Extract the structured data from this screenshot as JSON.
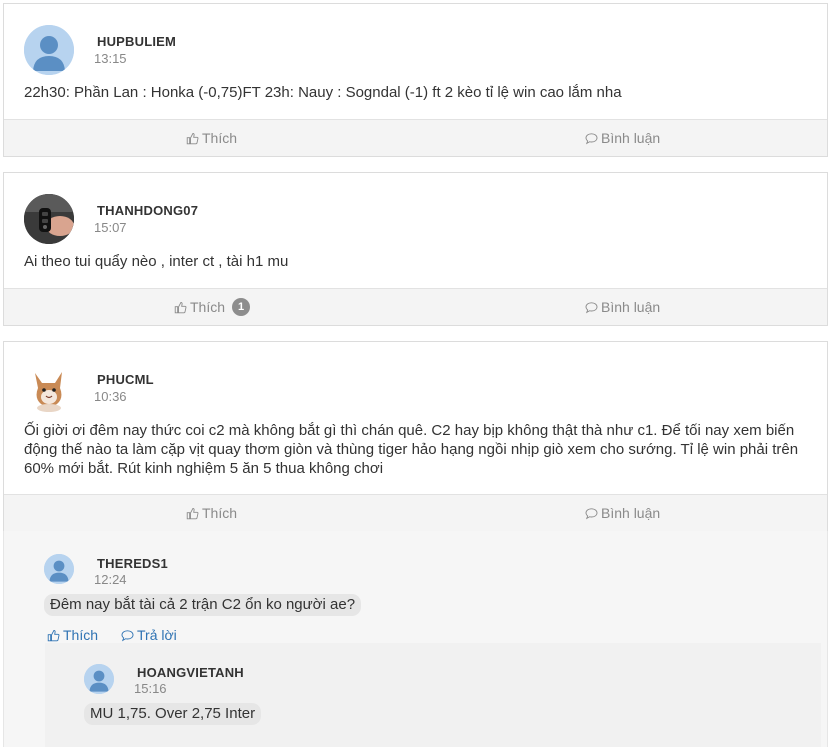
{
  "posts": [
    {
      "username": "HUPBULIEM",
      "time": "13:15",
      "content": "22h30: Phần Lan : Honka (-0,75)FT 23h: Nauy : Sogndal (-1) ft 2 kèo tỉ lệ win cao lắm nha",
      "like_label": "Thích",
      "comment_label": "Bình luận"
    },
    {
      "username": "THANHDONG07",
      "time": "15:07",
      "content": "Ai theo tui quẩy nèo , inter ct , tài h1 mu",
      "like_label": "Thích",
      "like_count": "1",
      "comment_label": "Bình luận"
    },
    {
      "username": "PHUCML",
      "time": "10:36",
      "content": "Ối giời ơi đêm nay thức coi c2 mà không bắt gì thì chán quê. C2 hay bịp không thật thà như c1. Để tối nay xem biến động thế nào ta làm cặp vịt quay thơm giòn và thùng tiger hảo hạng ngồi nhịp giò xem cho sướng. Tỉ lệ win phải trên 60% mới bắt. Rút kinh nghiệm 5 ăn 5 thua không chơi",
      "like_label": "Thích",
      "comment_label": "Bình luận"
    }
  ],
  "comment": {
    "username": "THEREDS1",
    "time": "12:24",
    "content": "Đêm nay bắt tài cả 2 trận C2 ổn ko người ae?",
    "like_label": "Thích",
    "reply_label": "Trả lời"
  },
  "reply": {
    "username": "HOANGVIETANH",
    "time": "15:16",
    "content": "MU 1,75. Over 2,75 Inter"
  },
  "colors": {
    "link_blue": "#2f73b3",
    "action_gray": "#8a8a8a",
    "avatar_blue": "#b7d3ef",
    "silhouette_blue": "#5b8fc4"
  },
  "icons": {
    "like": "thumbs-up-icon",
    "comment": "comment-bubble-icon",
    "avatar": "user-silhouette-icon"
  }
}
